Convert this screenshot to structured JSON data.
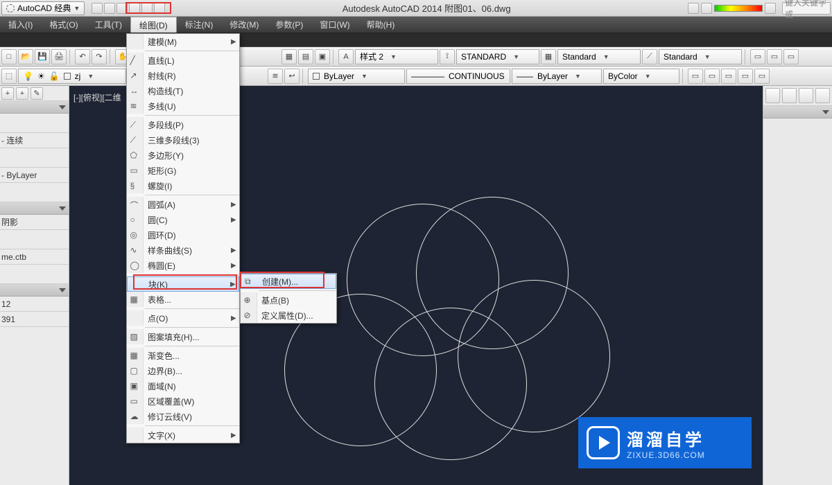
{
  "title": {
    "workspace": "AutoCAD 经典",
    "app": "Autodesk AutoCAD 2014    附图01、06.dwg",
    "search_placeholder": "键入关键字或"
  },
  "menubar": {
    "insert": "插入(I)",
    "format": "格式(O)",
    "tools": "工具(T)",
    "draw": "绘图(D)",
    "dim": "标注(N)",
    "modify": "修改(M)",
    "param": "参数(P)",
    "window": "窗口(W)",
    "help": "帮助(H)"
  },
  "toolbar1": {
    "text_style_label": "样式 2",
    "dim_style_label": "STANDARD",
    "table_style_label": "Standard",
    "mleader_style_label": "Standard"
  },
  "toolbar2": {
    "layer_name": "zj",
    "color_drop": "ByLayer",
    "linetype_drop": "CONTINUOUS",
    "lineweight_drop": "ByLayer",
    "plotstyle_drop": "ByColor"
  },
  "left_panel": {
    "r1": "- 连续",
    "r2": "- ByLayer",
    "r3": "阴影",
    "r4": "me.ctb",
    "r5": "12",
    "r6": "391"
  },
  "viewport_label": "[-][俯视][二维",
  "draw_menu": {
    "modeling": "建模(M)",
    "line": "直线(L)",
    "ray": "射线(R)",
    "xline": "构造线(T)",
    "mline": "多线(U)",
    "pline": "多段线(P)",
    "pline3d": "三维多段线(3)",
    "polygon": "多边形(Y)",
    "rect": "矩形(G)",
    "helix": "螺旋(I)",
    "arc": "圆弧(A)",
    "circle": "圆(C)",
    "donut": "圆环(D)",
    "spline": "样条曲线(S)",
    "ellipse": "椭圆(E)",
    "block": "块(K)",
    "table": "表格...",
    "point": "点(O)",
    "hatch": "图案填充(H)...",
    "gradient": "渐变色...",
    "boundary": "边界(B)...",
    "region": "面域(N)",
    "wipeout": "区域覆盖(W)",
    "revcloud": "修订云线(V)",
    "text": "文字(X)"
  },
  "block_submenu": {
    "make": "创建(M)...",
    "base": "基点(B)",
    "attdef": "定义属性(D)..."
  },
  "watermark": {
    "title": "溜溜自学",
    "url": "ZIXUE.3D66.COM"
  }
}
